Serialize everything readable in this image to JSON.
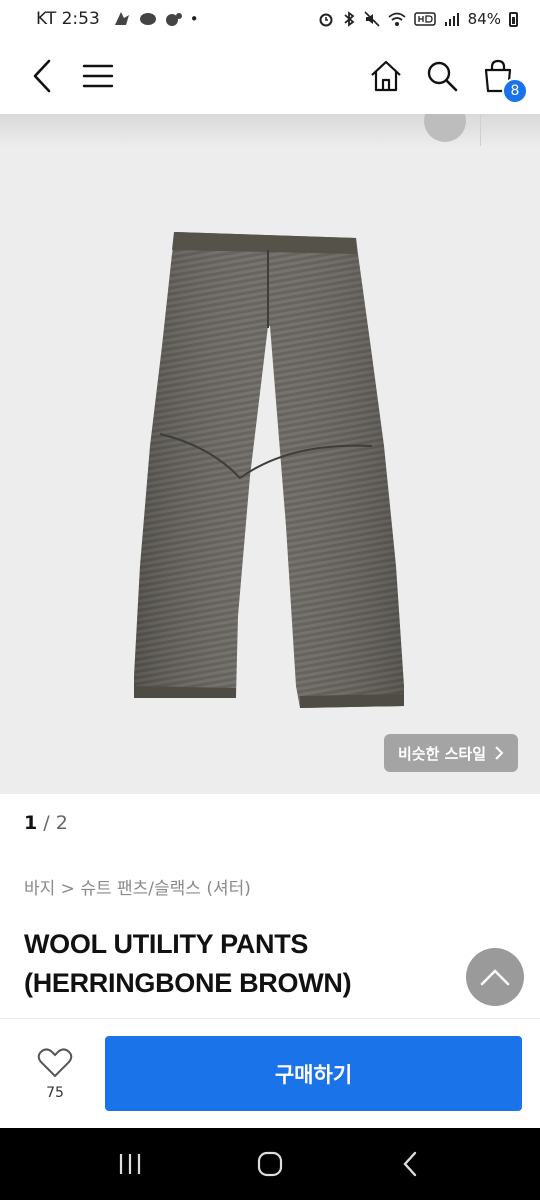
{
  "status": {
    "carrier_time": "KT 2:53",
    "battery": "84%"
  },
  "nav": {
    "cart_count": "8"
  },
  "product": {
    "similar_style_label": "비슷한 스타일",
    "pager_current": "1",
    "pager_total": "2",
    "breadcrumb": "바지 > 슈트 팬츠/슬랙스 (셔터)",
    "title": "WOOL UTILITY PANTS (HERRINGBONE BROWN)"
  },
  "action": {
    "like_count": "75",
    "buy_label": "구매하기"
  },
  "colors": {
    "accent": "#1a73e8",
    "pants": "#6b6862"
  }
}
